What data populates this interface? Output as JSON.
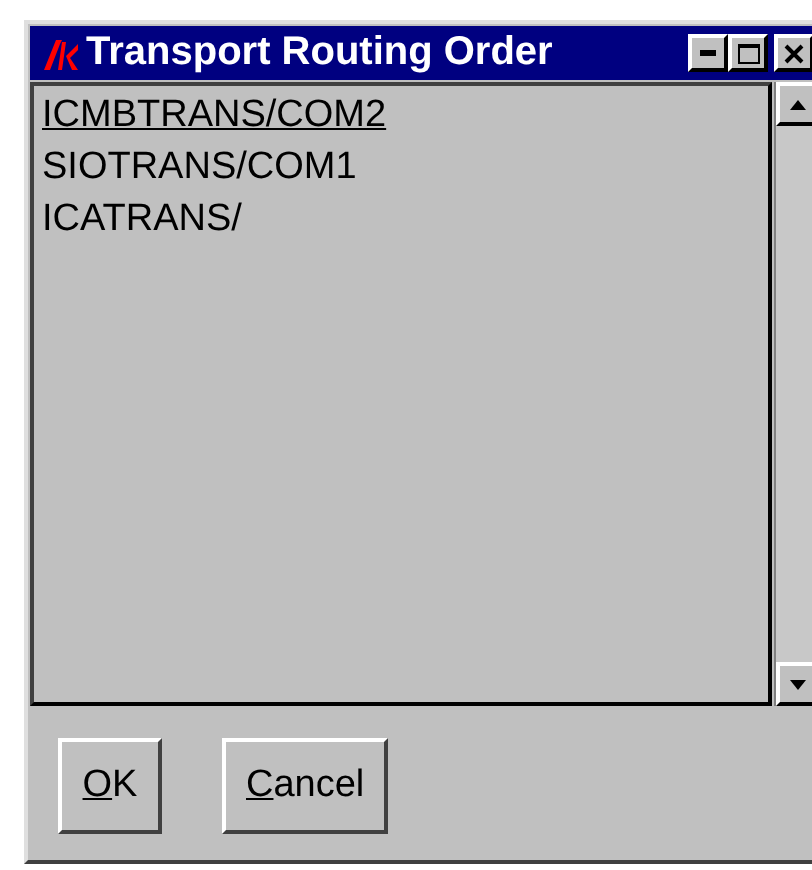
{
  "window": {
    "title": "Transport Routing Order"
  },
  "list": {
    "items": [
      {
        "text": "ICMBTRANS/COM2",
        "active": true
      },
      {
        "text": "SIOTRANS/COM1",
        "active": false
      },
      {
        "text": "ICATRANS/",
        "active": false
      }
    ]
  },
  "buttons": [
    {
      "mnemonic": "O",
      "rest": "K"
    },
    {
      "mnemonic": "C",
      "rest": "ancel"
    }
  ]
}
